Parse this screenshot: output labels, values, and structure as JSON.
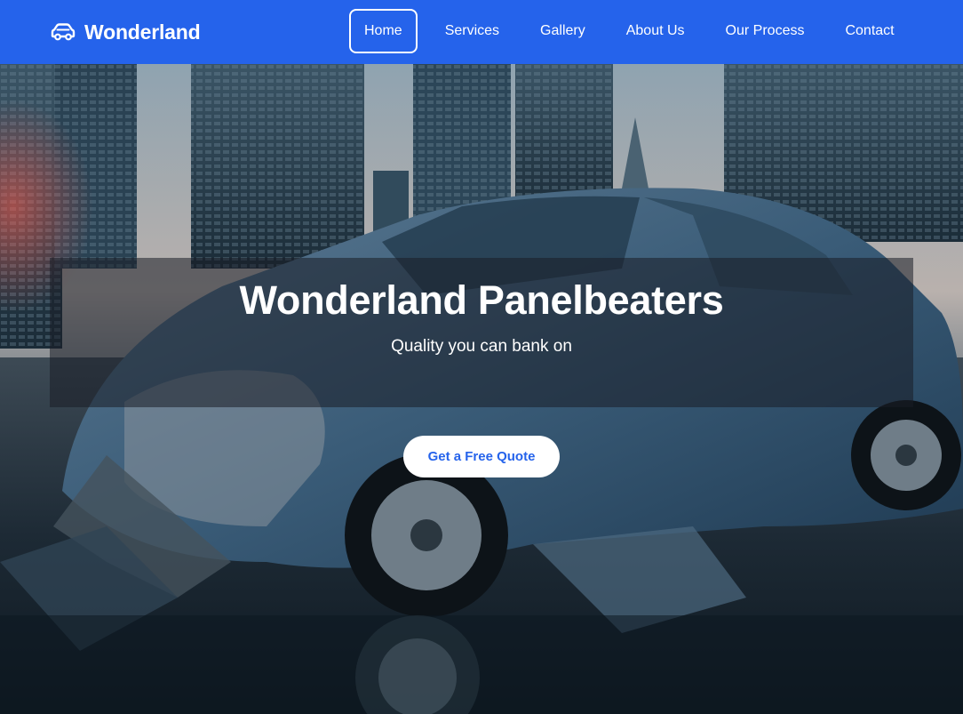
{
  "nav": {
    "brand": "Wonderland",
    "brand_icon": "car-icon",
    "links": [
      {
        "label": "Home",
        "active": true
      },
      {
        "label": "Services"
      },
      {
        "label": "Gallery"
      },
      {
        "label": "About Us"
      },
      {
        "label": "Our Process"
      },
      {
        "label": "Contact"
      }
    ]
  },
  "hero": {
    "title": "Wonderland Panelbeaters",
    "subtitle": "Quality you can bank on",
    "cta": "Get a Free Quote",
    "background": "crashed-car-city-photo"
  },
  "colors": {
    "nav_bg": "#2563eb",
    "cta_text": "#2563eb",
    "cta_bg": "#ffffff"
  }
}
